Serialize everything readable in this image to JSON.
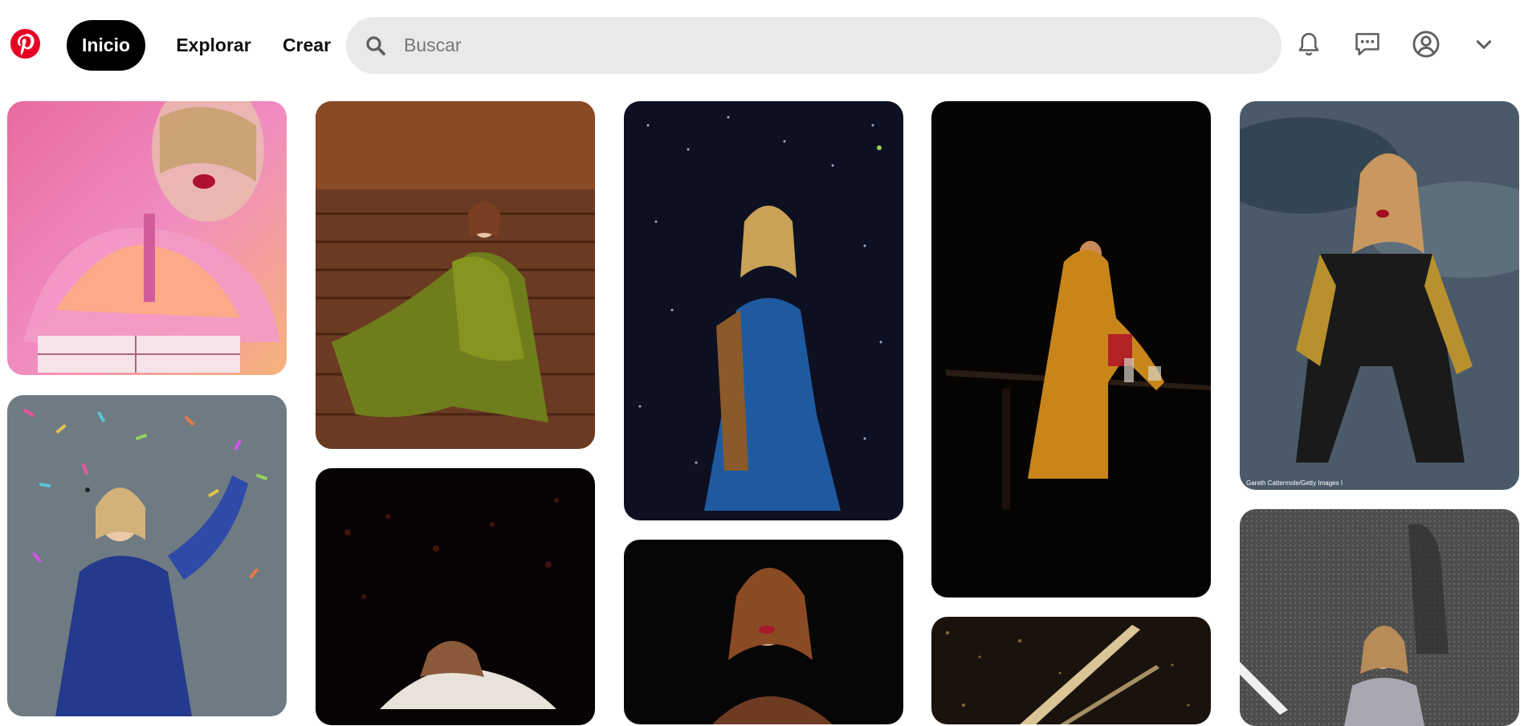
{
  "header": {
    "nav": {
      "home_label": "Inicio",
      "explore_label": "Explorar",
      "create_label": "Crear"
    },
    "search": {
      "placeholder": "Buscar"
    },
    "icons": [
      "pinterest-logo",
      "search-icon",
      "bell-icon",
      "messages-icon",
      "profile-icon",
      "chevron-down-icon"
    ]
  },
  "pins": {
    "caption": "Gareth Cattermole/Getty Images I"
  },
  "colors": {
    "brand": "#e60023",
    "active_nav": "#000000",
    "search_bg": "#e9e9e9"
  }
}
